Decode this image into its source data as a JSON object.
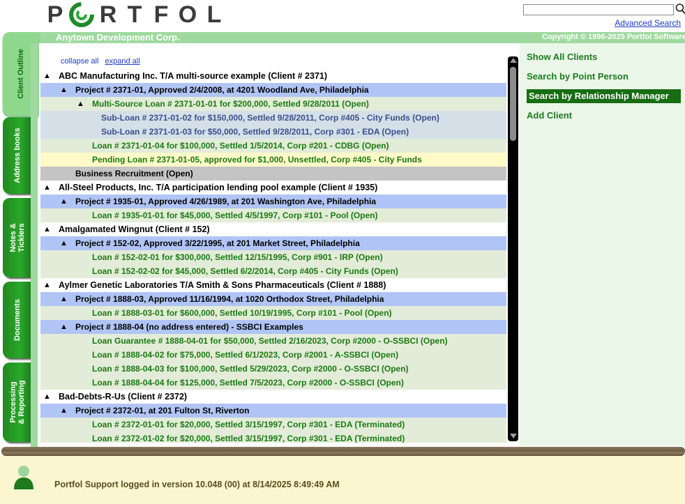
{
  "header": {
    "logo_letters": [
      "P",
      "",
      "R",
      "T",
      "F",
      "O",
      "L"
    ],
    "search_placeholder": "",
    "advanced_search_label": "Advanced Search"
  },
  "banner": {
    "company": "Anytown Development Corp.",
    "copyright": "Copyright © 1996-2025 Portfol Software"
  },
  "left_tabs": [
    {
      "label": "Client Outline",
      "active": true
    },
    {
      "label": "Address books",
      "active": false
    },
    {
      "label": "Notes & Ticklers",
      "active": false
    },
    {
      "label": "Documents",
      "active": false
    },
    {
      "label": "Processing & Reporting",
      "active": false
    }
  ],
  "outline": {
    "collapse_all": "collapse all",
    "expand_all": "expand all",
    "rows": [
      {
        "kind": "client",
        "level": 0,
        "tri": true,
        "text": "ABC Manufacturing Inc. T/A multi-source example (Client # 2371)"
      },
      {
        "kind": "project",
        "level": 1,
        "tri": true,
        "text": "Project # 2371-01, Approved 2/4/2008, at 4201 Woodland Ave, Philadelphia"
      },
      {
        "kind": "loan",
        "level": 2,
        "tri": true,
        "text": "Multi-Source Loan # 2371-01-01 for $200,000, Settled 9/28/2011 (Open)"
      },
      {
        "kind": "subloan",
        "level": 3,
        "tri": false,
        "text": "Sub-Loan # 2371-01-02 for $150,000, Settled 9/28/2011, Corp #405 - City Funds (Open)"
      },
      {
        "kind": "subloan",
        "level": 3,
        "tri": false,
        "text": "Sub-Loan # 2371-01-03 for $50,000, Settled 9/28/2011, Corp #301 - EDA (Open)"
      },
      {
        "kind": "loan",
        "level": 2,
        "tri": false,
        "text": "Loan # 2371-01-04 for $100,000, Settled 1/5/2014, Corp #201 - CDBG (Open)"
      },
      {
        "kind": "pending",
        "level": 2,
        "tri": false,
        "text": "Pending Loan # 2371-01-05, approved for $1,000, Unsettled, Corp #405 - City Funds"
      },
      {
        "kind": "business",
        "level": 1,
        "tri": false,
        "text": "Business Recruitment (Open)"
      },
      {
        "kind": "client",
        "level": 0,
        "tri": true,
        "text": "All-Steel Products, Inc. T/A participation lending pool example (Client # 1935)"
      },
      {
        "kind": "project",
        "level": 1,
        "tri": true,
        "text": "Project # 1935-01, Approved 4/26/1989, at 201 Washington Ave, Philadelphia"
      },
      {
        "kind": "loan",
        "level": 2,
        "tri": false,
        "text": "Loan # 1935-01-01 for $45,000, Settled 4/5/1997, Corp #101 - Pool (Open)"
      },
      {
        "kind": "client",
        "level": 0,
        "tri": true,
        "text": "Amalgamated Wingnut (Client # 152)"
      },
      {
        "kind": "project",
        "level": 1,
        "tri": true,
        "text": "Project # 152-02, Approved 3/22/1995, at 201 Market Street, Philadelphia"
      },
      {
        "kind": "loan",
        "level": 2,
        "tri": false,
        "text": "Loan # 152-02-01 for $300,000, Settled 12/15/1995, Corp #901 - IRP (Open)"
      },
      {
        "kind": "loan",
        "level": 2,
        "tri": false,
        "text": "Loan # 152-02-02 for $45,000, Settled 6/2/2014, Corp #405 - City Funds (Open)"
      },
      {
        "kind": "client",
        "level": 0,
        "tri": true,
        "text": "Aylmer Genetic Laboratories T/A Smith & Sons Pharmaceuticals (Client # 1888)"
      },
      {
        "kind": "project",
        "level": 1,
        "tri": true,
        "text": "Project # 1888-03, Approved 11/16/1994, at 1020 Orthodox Street, Philadelphia"
      },
      {
        "kind": "loan",
        "level": 2,
        "tri": false,
        "text": "Loan # 1888-03-01 for $600,000, Settled 10/19/1995, Corp #101 - Pool (Open)"
      },
      {
        "kind": "project",
        "level": 1,
        "tri": true,
        "text": "Project # 1888-04 (no address entered) - SSBCI Examples"
      },
      {
        "kind": "loan",
        "level": 2,
        "tri": false,
        "text": "Loan Guarantee # 1888-04-01 for $50,000, Settled 2/16/2023, Corp #2000 - O-SSBCI (Open)"
      },
      {
        "kind": "loan",
        "level": 2,
        "tri": false,
        "text": "Loan # 1888-04-02 for $75,000, Settled 6/1/2023, Corp #2001 - A-SSBCI (Open)"
      },
      {
        "kind": "loan",
        "level": 2,
        "tri": false,
        "text": "Loan # 1888-04-03 for $100,000, Settled 5/29/2023, Corp #2000 - O-SSBCI (Open)"
      },
      {
        "kind": "loan",
        "level": 2,
        "tri": false,
        "text": "Loan # 1888-04-04 for $125,000, Settled 7/5/2023, Corp #2000 - O-SSBCI (Open)"
      },
      {
        "kind": "client",
        "level": 0,
        "tri": true,
        "text": "Bad-Debts-R-Us (Client # 2372)"
      },
      {
        "kind": "project",
        "level": 1,
        "tri": true,
        "text": "Project # 2372-01, at 201 Fulton St, Riverton"
      },
      {
        "kind": "loan",
        "level": 2,
        "tri": false,
        "text": "Loan # 2372-01-01 for $20,000, Settled 3/15/1997, Corp #301 - EDA (Terminated)"
      },
      {
        "kind": "loan",
        "level": 2,
        "tri": false,
        "text": "Loan # 2372-01-02 for $20,000, Settled 3/15/1997, Corp #301 - EDA (Terminated)"
      }
    ]
  },
  "side_panel": {
    "links": [
      {
        "label": "Show All Clients",
        "active": false
      },
      {
        "label": "Search by Point Person",
        "active": false
      },
      {
        "label": "Search by Relationship Manager",
        "active": true
      },
      {
        "label": "Add Client",
        "active": false
      }
    ]
  },
  "footer": {
    "status": "Portfol Support logged in version 10.048 (00) at 8/14/2025 8:49:49 AM"
  },
  "colors": {
    "brand_green": "#1f8a1f",
    "banner_green": "#9fd99f",
    "project_row": "#b0c4f5",
    "loan_row": "#e3ecd8",
    "subloan_row": "#d4dfe8",
    "pending_row": "#fffac8",
    "business_row": "#c4c4c4",
    "footer_bg": "#fbf6d0"
  }
}
